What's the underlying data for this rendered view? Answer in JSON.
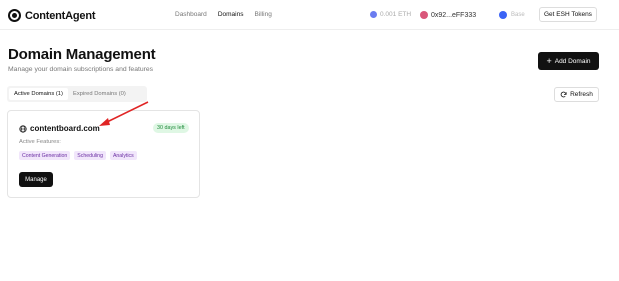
{
  "header": {
    "logo_text": "ContentAgent",
    "nav": [
      {
        "label": "Dashboard"
      },
      {
        "label": "Domains",
        "active": true
      },
      {
        "label": "Billing"
      }
    ],
    "balance": "0.001 ETH",
    "wallet": "0x92...eFF333",
    "network": "Base",
    "tokens_button": "Get ESH Tokens"
  },
  "page": {
    "title": "Domain Management",
    "subtitle": "Manage your domain subscriptions and features",
    "add_button": "Add Domain",
    "tabs": [
      {
        "label": "Active Domains (1)",
        "active": true
      },
      {
        "label": "Expired Domains (0)",
        "active": false
      }
    ],
    "refresh_button": "Refresh"
  },
  "domains": [
    {
      "name": "contentboard.com",
      "days_left": "30 days left",
      "features_label": "Active Features:",
      "features": [
        "Content Generation",
        "Scheduling",
        "Analytics"
      ],
      "manage_button": "Manage"
    }
  ],
  "colors": {
    "primary": "#111111",
    "badge_green_bg": "#dff7e4",
    "badge_green_text": "#1f8a3b",
    "tag_purple_bg": "#f1e6fb",
    "tag_purple_text": "#6b2fa3",
    "annotation_arrow": "#e02424"
  }
}
